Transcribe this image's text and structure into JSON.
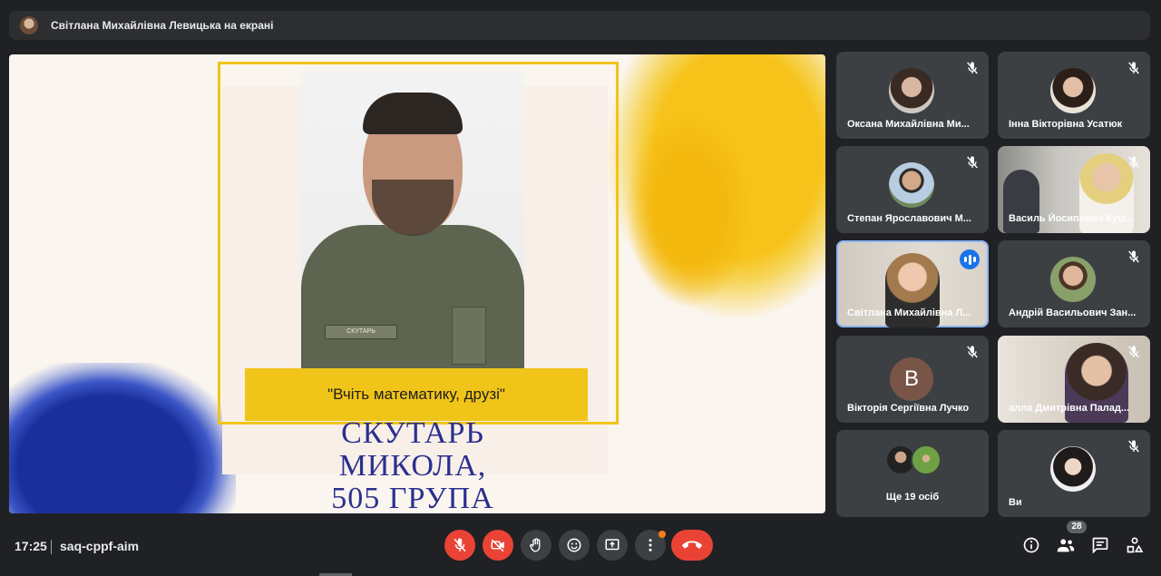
{
  "presenting_banner": "Світлана Михайлівна Левицька на екрані",
  "slide": {
    "quote": "\"Вчіть математику, друзі\"",
    "name_line1": "СКУТАРЬ",
    "name_line2": "МИКОЛА,",
    "name_line3": "505 ГРУПА",
    "tag_text": "СКУТАРЬ"
  },
  "participants": [
    {
      "name": "Оксана Михайлівна Ми...",
      "muted": true
    },
    {
      "name": "Інна Вікторівна Усатюк",
      "muted": true
    },
    {
      "name": "Степан Ярославович М...",
      "muted": true
    },
    {
      "name": "Василь Йосипович Куш...",
      "muted": true
    },
    {
      "name": "Світлана Михайлівна Л...",
      "muted": false,
      "speaking": true
    },
    {
      "name": "Андрій Васильович Зан...",
      "muted": true
    },
    {
      "name": "Вікторія Сергіївна Лучко",
      "muted": true,
      "initial": "В"
    },
    {
      "name": "алла Дмитрівна Палад...",
      "muted": true
    },
    {
      "name": "Ще 19 осіб"
    },
    {
      "name": "Ви",
      "muted": true
    }
  ],
  "bottom": {
    "time": "17:25",
    "meeting_code": "saq-cppf-aim",
    "participant_count": "28"
  },
  "colors": {
    "background": "#202124",
    "tile": "#3c4043",
    "danger": "#ea4335",
    "accent_blue": "#1a73e8",
    "slide_yellow": "#f0c419",
    "slide_navy": "#2a2f8f"
  }
}
